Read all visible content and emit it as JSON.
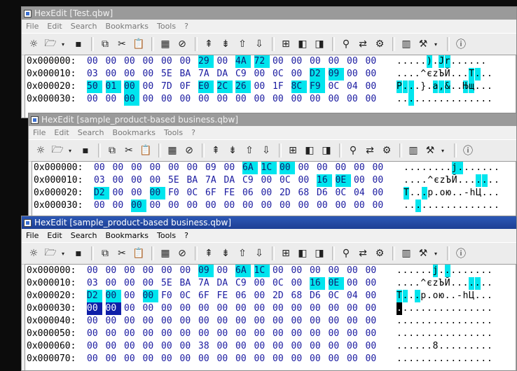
{
  "menu": [
    "File",
    "Edit",
    "Search",
    "Bookmarks",
    "Tools",
    "?"
  ],
  "toolbar_icons": [
    "new-icon",
    "open-icon",
    "dropdown-icon",
    "save-icon",
    "copy-icon",
    "cut-icon",
    "paste-icon",
    "insert-icon",
    "delete-icon",
    "page-up-icon",
    "page-down-icon",
    "jump-up-icon",
    "jump-down-icon",
    "bookmark-add-icon",
    "bookmark-prev-icon",
    "bookmark-next-icon",
    "find-icon",
    "replace-icon",
    "options-icon",
    "properties-icon",
    "settings-icon",
    "settings-dropdown-icon",
    "about-icon"
  ],
  "windows": [
    {
      "title": "HexEdit [Test.qbw]",
      "active": false,
      "rows": [
        {
          "offset": "0x000000:",
          "bytes": [
            "00",
            "00",
            "00",
            "00",
            "00",
            "00",
            "29",
            "00",
            "4A",
            "72",
            "00",
            "00",
            "00",
            "00",
            "00",
            "00"
          ],
          "hl": [
            6,
            8,
            9
          ],
          "ascii": ".....).Jr......",
          "ahl": [
            5,
            7,
            8
          ]
        },
        {
          "offset": "0x000010:",
          "bytes": [
            "03",
            "00",
            "00",
            "00",
            "5E",
            "BA",
            "7A",
            "DA",
            "C9",
            "00",
            "0C",
            "00",
            "D2",
            "09",
            "00",
            "00"
          ],
          "hl": [
            12,
            13
          ],
          "ascii": "....^єzЪЙ...T...",
          "ahl": [
            12,
            13
          ]
        },
        {
          "offset": "0x000020:",
          "bytes": [
            "50",
            "01",
            "00",
            "00",
            "7D",
            "0F",
            "E0",
            "2C",
            "26",
            "00",
            "1F",
            "8C",
            "F9",
            "0C",
            "04",
            "00"
          ],
          "hl": [
            0,
            1,
            2,
            6,
            7,
            8,
            11,
            12
          ],
          "ascii": "P...}.a,&..Њщ...",
          "ahl": [
            0,
            1,
            2,
            6,
            7,
            8,
            11,
            12
          ]
        },
        {
          "offset": "0x000030:",
          "bytes": [
            "00",
            "00",
            "00",
            "00",
            "00",
            "00",
            "00",
            "00",
            "00",
            "00",
            "00",
            "00",
            "00",
            "00",
            "00",
            "00"
          ],
          "hl": [
            2
          ],
          "ascii": "................",
          "ahl": [
            2
          ]
        }
      ]
    },
    {
      "title": "HexEdit [sample_product-based business.qbw]",
      "active": false,
      "rows": [
        {
          "offset": "0x000000:",
          "bytes": [
            "00",
            "00",
            "00",
            "00",
            "00",
            "00",
            "09",
            "00",
            "6A",
            "1C",
            "00",
            "00",
            "00",
            "00",
            "00",
            "00"
          ],
          "hl": [
            8,
            9,
            10
          ],
          "ascii": "........j.......",
          "ahl": [
            8,
            9
          ]
        },
        {
          "offset": "0x000010:",
          "bytes": [
            "03",
            "00",
            "00",
            "00",
            "5E",
            "BA",
            "7A",
            "DA",
            "C9",
            "00",
            "0C",
            "00",
            "16",
            "0E",
            "00",
            "00"
          ],
          "hl": [
            12,
            13
          ],
          "ascii": "....^єzЪЙ.......",
          "ahl": [
            12,
            13
          ]
        },
        {
          "offset": "0x000020:",
          "bytes": [
            "D2",
            "00",
            "00",
            "00",
            "F0",
            "0C",
            "6F",
            "FE",
            "06",
            "00",
            "2D",
            "68",
            "D6",
            "0C",
            "04",
            "00"
          ],
          "hl": [
            0,
            3
          ],
          "ascii": "T...p.ою..-hЦ...",
          "ahl": [
            0,
            3
          ]
        },
        {
          "offset": "0x000030:",
          "bytes": [
            "00",
            "00",
            "00",
            "00",
            "00",
            "00",
            "00",
            "00",
            "00",
            "00",
            "00",
            "00",
            "00",
            "00",
            "00",
            "00"
          ],
          "hl": [
            2
          ],
          "ascii": "................",
          "ahl": [
            2
          ]
        }
      ]
    },
    {
      "title": "HexEdit [sample_product-based business.qbw]",
      "active": true,
      "rows": [
        {
          "offset": "0x000000:",
          "bytes": [
            "00",
            "00",
            "00",
            "00",
            "00",
            "00",
            "09",
            "00",
            "6A",
            "1C",
            "00",
            "00",
            "00",
            "00",
            "00",
            "00"
          ],
          "hl": [
            6,
            8,
            9
          ],
          "ascii": "......j.........",
          "ahl": [
            6,
            8
          ]
        },
        {
          "offset": "0x000010:",
          "bytes": [
            "03",
            "00",
            "00",
            "00",
            "5E",
            "BA",
            "7A",
            "DA",
            "C9",
            "00",
            "0C",
            "00",
            "16",
            "0E",
            "00",
            "00"
          ],
          "hl": [
            12,
            13
          ],
          "ascii": "....^єzЪЙ.......",
          "ahl": [
            12,
            13
          ]
        },
        {
          "offset": "0x000020:",
          "bytes": [
            "D2",
            "00",
            "00",
            "00",
            "F0",
            "0C",
            "6F",
            "FE",
            "06",
            "00",
            "2D",
            "68",
            "D6",
            "0C",
            "04",
            "00"
          ],
          "hl": [
            0,
            1,
            3
          ],
          "ascii": "T...p.ою..-hЦ...",
          "ahl": [
            0,
            1,
            3
          ]
        },
        {
          "offset": "0x000030:",
          "bytes": [
            "00",
            "00",
            "00",
            "00",
            "00",
            "00",
            "00",
            "00",
            "00",
            "00",
            "00",
            "00",
            "00",
            "00",
            "00",
            "00"
          ],
          "sel": [
            0,
            1
          ],
          "hl": [],
          "ascii": "................",
          "ahl": [],
          "cur": [
            0
          ]
        },
        {
          "offset": "0x000040:",
          "bytes": [
            "00",
            "00",
            "00",
            "00",
            "00",
            "00",
            "00",
            "00",
            "00",
            "00",
            "00",
            "00",
            "00",
            "00",
            "00",
            "00"
          ],
          "hl": [],
          "ascii": "................",
          "ahl": []
        },
        {
          "offset": "0x000050:",
          "bytes": [
            "00",
            "00",
            "00",
            "00",
            "00",
            "00",
            "00",
            "00",
            "00",
            "00",
            "00",
            "00",
            "00",
            "00",
            "00",
            "00"
          ],
          "hl": [],
          "ascii": "................",
          "ahl": []
        },
        {
          "offset": "0x000060:",
          "bytes": [
            "00",
            "00",
            "00",
            "00",
            "00",
            "00",
            "38",
            "00",
            "00",
            "00",
            "00",
            "00",
            "00",
            "00",
            "00",
            "00"
          ],
          "hl": [],
          "ascii": "......8.........",
          "ahl": []
        },
        {
          "offset": "0x000070:",
          "bytes": [
            "00",
            "00",
            "00",
            "00",
            "00",
            "00",
            "00",
            "00",
            "00",
            "00",
            "00",
            "00",
            "00",
            "00",
            "00",
            "00"
          ],
          "hl": [],
          "ascii": "................",
          "ahl": []
        }
      ]
    }
  ]
}
